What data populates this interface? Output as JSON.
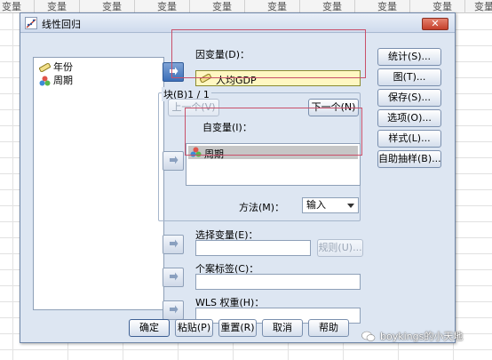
{
  "spreadsheet": {
    "column_header": [
      "变量",
      "变量",
      "变量",
      "变量",
      "变量",
      "变量",
      "变量",
      "变量",
      "变量",
      "变量",
      "变量"
    ]
  },
  "dialog": {
    "title": "线性回归",
    "close_label": "✕",
    "source_vars": [
      {
        "name": "年份",
        "icon": "scale-ruler-icon"
      },
      {
        "name": "周期",
        "icon": "nominal-balls-icon"
      }
    ],
    "dependent_label": "因变量(D)：",
    "dependent_value": "人均GDP",
    "block_label": "块(B)1 / 1",
    "prev_button": "上一个(V)",
    "next_button": "下一个(N)",
    "independent_label": "自变量(I)：",
    "independent_value": "周期",
    "method_label": "方法(M)：",
    "method_value": "输入",
    "selection_label": "选择变量(E)：",
    "rule_button": "规则(U)...",
    "case_label_label": "个案标签(C)：",
    "wls_label": "WLS 权重(H)：",
    "side_buttons": [
      "统计(S)...",
      "图(T)...",
      "保存(S)...",
      "选项(O)...",
      "样式(L)...",
      "自助抽样(B)..."
    ],
    "bottom_buttons": [
      "确定",
      "粘贴(P)",
      "重置(R)",
      "取消",
      "帮助"
    ]
  },
  "watermark": "boykings的小天地",
  "colors": {
    "dialog_bg": "#dde6f2",
    "highlight_yellow": "#fff7c2",
    "annotation_red": "#c9506a",
    "close_red": "#c4402b"
  }
}
